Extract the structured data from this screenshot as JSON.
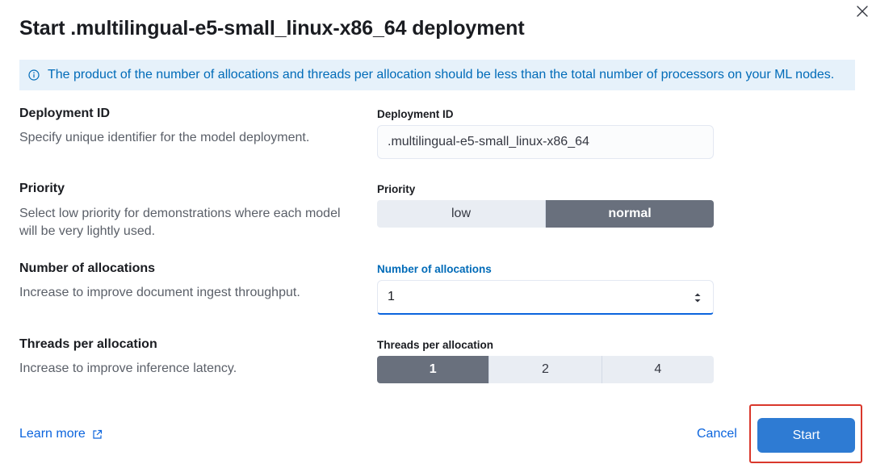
{
  "modal": {
    "title": "Start .multilingual-e5-small_linux-x86_64 deployment",
    "callout": "The product of the number of allocations and threads per allocation should be less than the total number of processors on your ML nodes."
  },
  "deployment_id": {
    "title": "Deployment ID",
    "description": "Specify unique identifier for the model deployment.",
    "field_label": "Deployment ID",
    "value": ".multilingual-e5-small_linux-x86_64"
  },
  "priority": {
    "title": "Priority",
    "description": "Select low priority for demonstrations where each model will be very lightly used.",
    "field_label": "Priority",
    "options": [
      "low",
      "normal"
    ],
    "selected": "normal"
  },
  "allocations": {
    "title": "Number of allocations",
    "description": "Increase to improve document ingest throughput.",
    "field_label": "Number of allocations",
    "value": "1"
  },
  "threads": {
    "title": "Threads per allocation",
    "description": "Increase to improve inference latency.",
    "field_label": "Threads per allocation",
    "options": [
      "1",
      "2",
      "4"
    ],
    "selected": "1"
  },
  "footer": {
    "learn_more": "Learn more",
    "cancel": "Cancel",
    "start": "Start"
  },
  "colors": {
    "accent": "#0b64dd",
    "callout_bg": "#e6f1fa",
    "selected_segment": "#69707d",
    "primary_button": "#2e7bd3",
    "highlight": "#d9372b"
  },
  "icons": {
    "close": "close-icon",
    "info": "info-icon",
    "external_link": "external-link-icon",
    "spinner": "spinner-arrows-icon"
  }
}
